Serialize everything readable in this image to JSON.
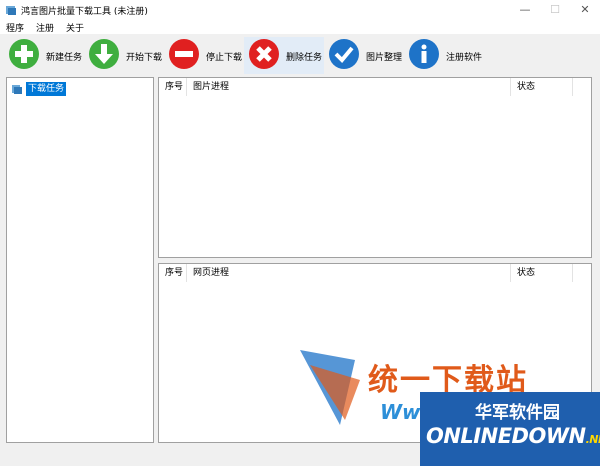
{
  "window": {
    "title": "鸿言图片批量下载工具 (未注册)",
    "controls": {
      "minimize": "—",
      "maximize": "☐",
      "close": "✕"
    }
  },
  "menu": [
    "程序",
    "注册",
    "关于"
  ],
  "toolbar": [
    {
      "label": "新建任务",
      "icon": "plus-icon",
      "color": "#3fae3f"
    },
    {
      "label": "开始下载",
      "icon": "arrow-down-icon",
      "color": "#3fae3f"
    },
    {
      "label": "停止下载",
      "icon": "minus-icon",
      "color": "#e02020"
    },
    {
      "label": "删除任务",
      "icon": "close-icon",
      "color": "#e02020"
    },
    {
      "label": "图片整理",
      "icon": "check-icon",
      "color": "#1e73c8"
    },
    {
      "label": "注册软件",
      "icon": "info-icon",
      "color": "#1e73c8"
    }
  ],
  "tree": {
    "item": "下载任务"
  },
  "image_table": {
    "col_index": "序号",
    "col_progress": "图片进程",
    "col_status": "状态"
  },
  "page_table": {
    "col_index": "序号",
    "col_progress": "网页进程",
    "col_status": "状态"
  },
  "watermark": {
    "cn": "统一下载站",
    "www": "Www",
    "badge_cn": "华军软件园",
    "badge_en": "ONLINEDOWN",
    "badge_en_suffix": ".NET"
  }
}
